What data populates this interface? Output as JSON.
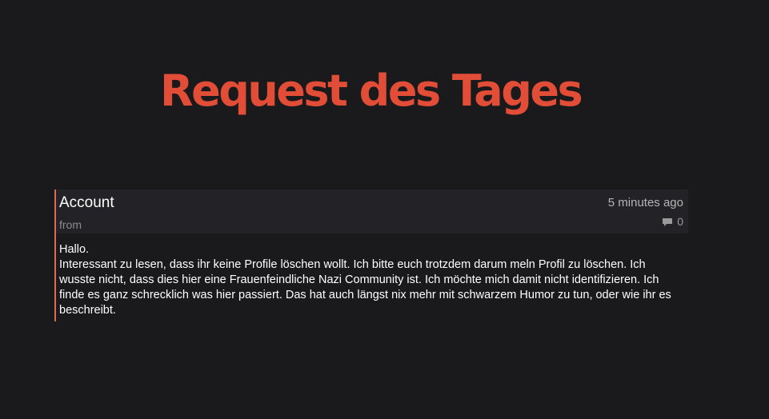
{
  "header": {
    "title": "Request des Tages"
  },
  "request": {
    "title": "Account",
    "from_label": "from",
    "time": "5 minutes ago",
    "comment_count": "0",
    "comment_icon": "comment-icon",
    "body_lines": [
      "Hallo.",
      "Interessant zu lesen, dass ihr keine Profile löschen wollt. Ich bitte euch trotzdem darum meln Profil zu löschen. Ich wusste nicht, dass dies hier eine Frauenfeindliche Nazi Community ist. Ich möchte mich damit nicht identifizieren. Ich finde es ganz schrecklich was hier passiert. Das hat auch längst nix mehr mit schwarzem Humor zu tun, oder wie ihr es beschreibt."
    ]
  },
  "colors": {
    "background": "#1a191b",
    "accent": "#e14d36",
    "card_header": "#232226",
    "card_border": "#e06a4a"
  }
}
